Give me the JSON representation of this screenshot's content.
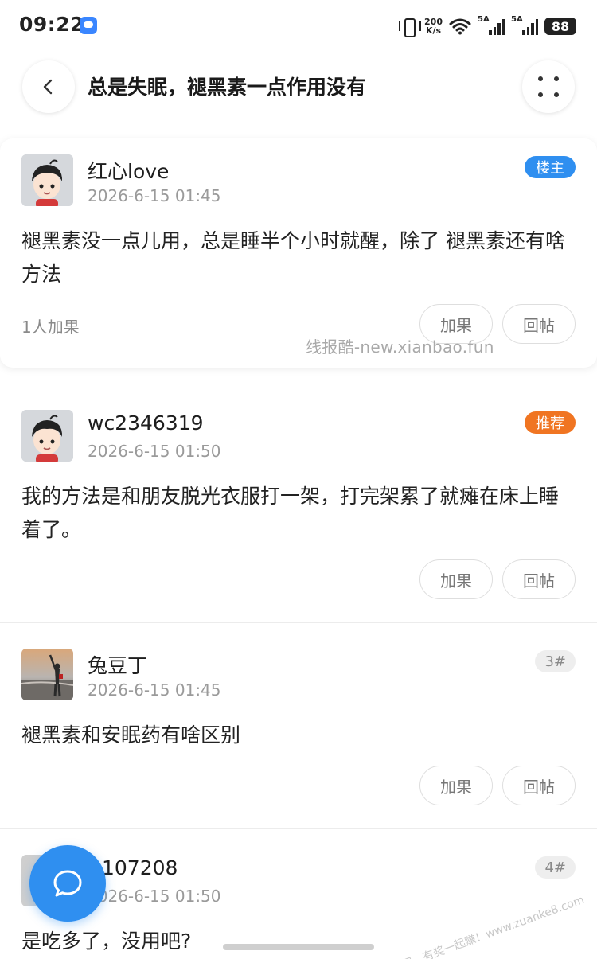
{
  "status_bar": {
    "time": "09:22",
    "net_speed_value": "200",
    "net_speed_unit": "K/s",
    "signal1_label": "5A",
    "signal2_label": "5A",
    "battery": "88"
  },
  "header": {
    "title": "总是失眠，褪黑素一点作用没有"
  },
  "posts": [
    {
      "username": "红心love",
      "time": "2026-6-15 01:45",
      "badge": "楼主",
      "content": "褪黑素没一点儿用，总是睡半个小时就醒，除了 褪黑素还有啥方法",
      "likes": "1人加果",
      "like_button": "加果",
      "reply_button": "回帖"
    },
    {
      "username": "wc2346319",
      "time": "2026-6-15 01:50",
      "badge": "推荐",
      "content": "我的方法是和朋友脱光衣服打一架，打完架累了就瘫在床上睡着了。",
      "like_button": "加果",
      "reply_button": "回帖"
    },
    {
      "username": "兔豆丁",
      "time": "2026-6-15 01:45",
      "badge": "3#",
      "content": "褪黑素和安眠药有啥区别",
      "like_button": "加果",
      "reply_button": "回帖"
    },
    {
      "username": "107208",
      "time": "2026-6-15 01:50",
      "badge": "4#",
      "content": "是吃多了，没用吧?"
    }
  ],
  "watermark": "线报酷-new.xianbao.fun",
  "corner_watermark": "赚客吧，有奖一起赚！www.zuanke8.com",
  "icons": {
    "back": "chevron-left-icon",
    "more": "more-dots-icon",
    "fab": "chat-bubble-icon"
  },
  "colors": {
    "accent": "#2f8ff0",
    "recommend": "#f07522"
  }
}
